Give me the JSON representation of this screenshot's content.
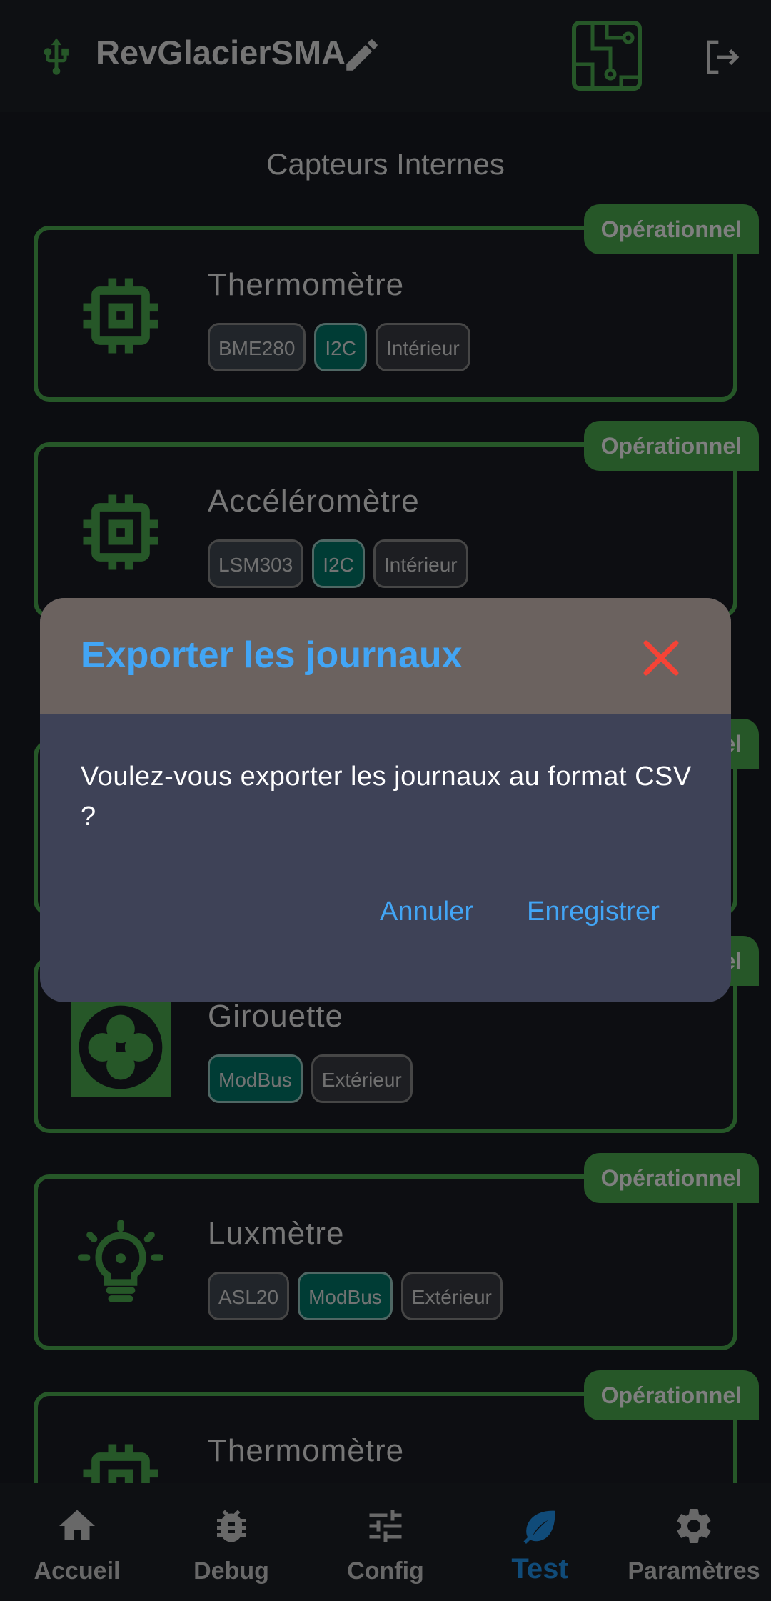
{
  "app": {
    "title": "RevGlacierSMA"
  },
  "section_title": "Capteurs Internes",
  "status_label": "Opérationnel",
  "sensors": [
    {
      "name": "Thermomètre",
      "icon": "chip-icon",
      "tags": [
        "BME280",
        "I2C",
        "Intérieur"
      ]
    },
    {
      "name": "Accéléromètre",
      "icon": "chip-icon",
      "tags": [
        "LSM303",
        "I2C",
        "Intérieur"
      ]
    },
    {
      "name": "Girouette",
      "icon": "fan-icon",
      "tags": [
        "ModBus",
        "Extérieur"
      ]
    },
    {
      "name": "Luxmètre",
      "icon": "lightbulb-icon",
      "tags": [
        "ASL20",
        "ModBus",
        "Extérieur"
      ]
    },
    {
      "name": "Thermomètre",
      "icon": "chip-icon",
      "tags": []
    }
  ],
  "dialog": {
    "title": "Exporter les journaux",
    "message": "Voulez-vous exporter les journaux au format CSV ?",
    "cancel_label": "Annuler",
    "confirm_label": "Enregistrer"
  },
  "nav": {
    "items": [
      {
        "label": "Accueil",
        "icon": "home-icon"
      },
      {
        "label": "Debug",
        "icon": "bug-icon"
      },
      {
        "label": "Config",
        "icon": "sliders-icon"
      },
      {
        "label": "Test",
        "icon": "leaf-icon",
        "active": true
      },
      {
        "label": "Paramètres",
        "icon": "gear-icon"
      }
    ]
  },
  "colors": {
    "accent_green": "#4caf50",
    "accent_blue": "#42a5f5",
    "close_red": "#f44336",
    "bus_teal": "#00796b"
  }
}
